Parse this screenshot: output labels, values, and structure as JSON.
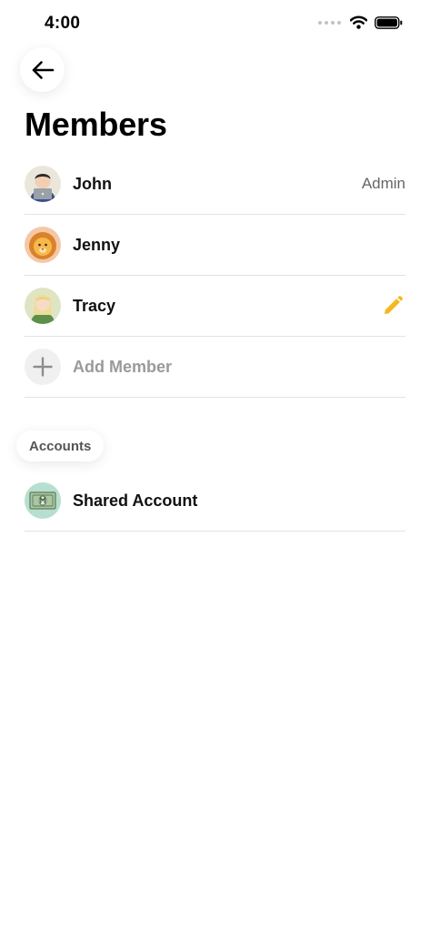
{
  "status_bar": {
    "time": "4:00"
  },
  "header": {
    "title": "Members"
  },
  "members": [
    {
      "name": "John",
      "role": "Admin"
    },
    {
      "name": "Jenny"
    },
    {
      "name": "Tracy"
    }
  ],
  "add_member": {
    "label": "Add Member"
  },
  "accounts": {
    "section_label": "Accounts",
    "items": [
      {
        "name": "Shared Account"
      }
    ]
  },
  "colors": {
    "accent": "#F5B820",
    "divider": "#E3E3E3",
    "muted_text": "#9A9A9A"
  }
}
